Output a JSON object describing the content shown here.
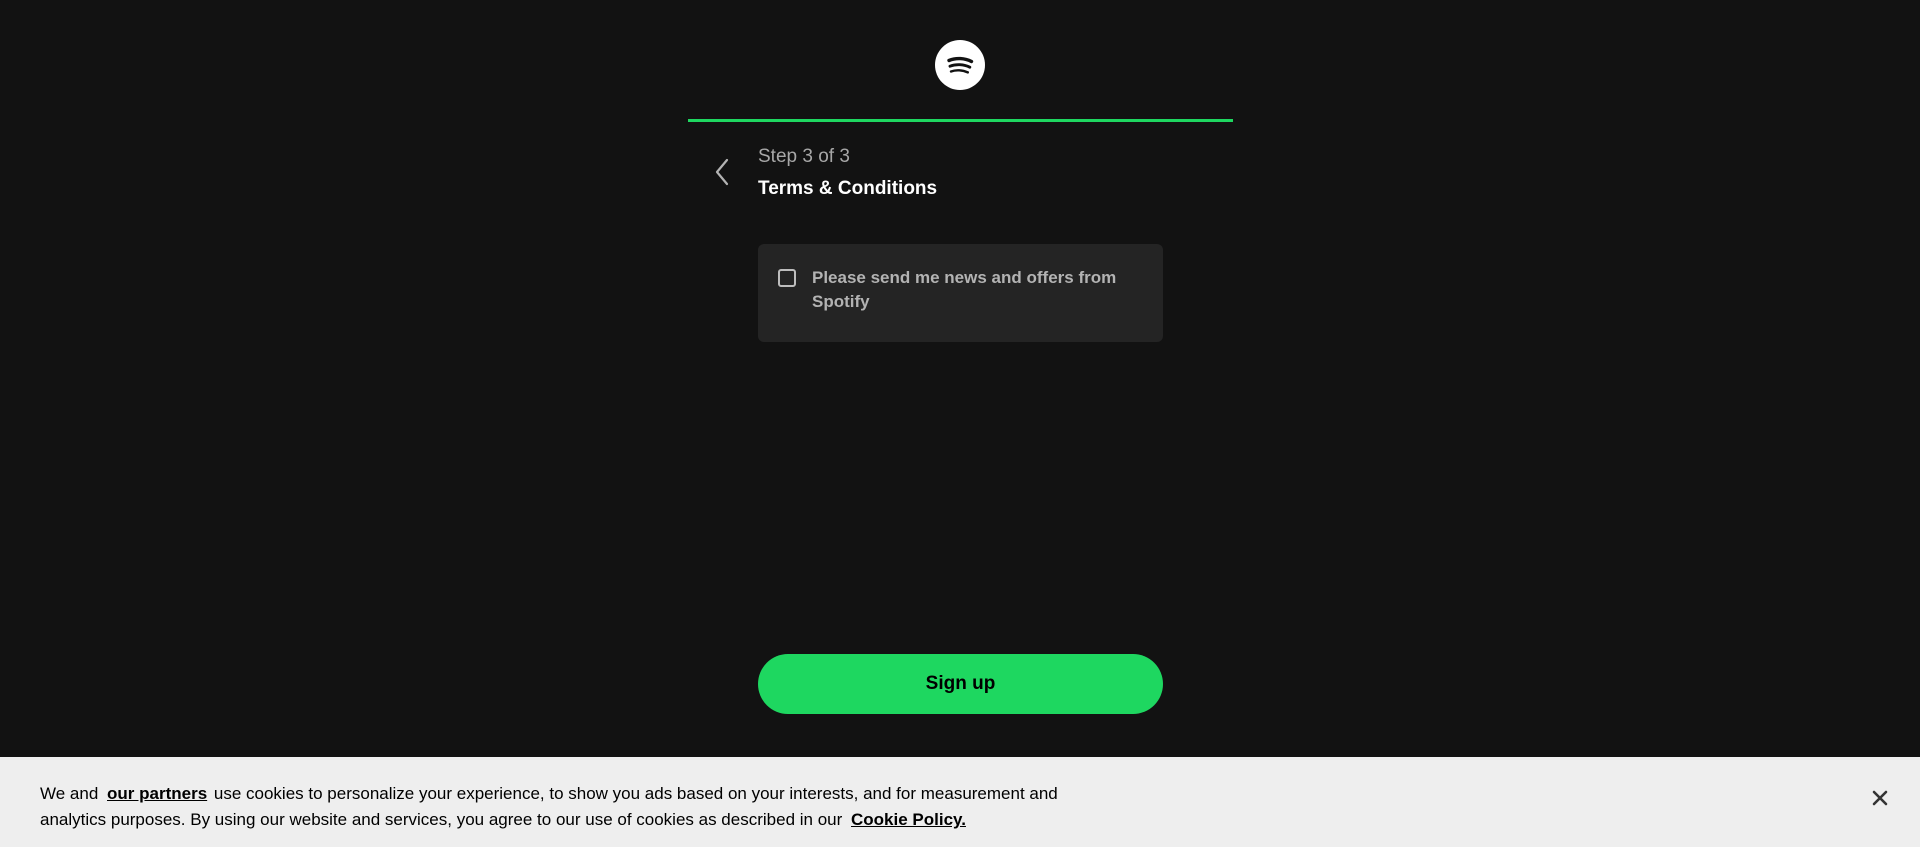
{
  "header": {
    "logo_icon": "spotify-logo-icon"
  },
  "progress": {
    "current_step": 3,
    "total_steps": 3,
    "fraction": 1.0,
    "fill_color": "#1ed760"
  },
  "step": {
    "back_icon": "chevron-left-icon",
    "label": "Step 3 of 3",
    "title": "Terms & Conditions"
  },
  "consent": {
    "checked": false,
    "label": "Please send me news and offers from Spotify"
  },
  "actions": {
    "signup_label": "Sign up",
    "accent_color": "#1ed760"
  },
  "cookie_banner": {
    "text_before_partners": "We and",
    "partners_link": "our partners",
    "text_after_partners": "use cookies to personalize your experience, to show you ads based on your interests, and for measurement and analytics purposes. By using our website and services, you agree to our use of cookies as described in our",
    "policy_link": "Cookie Policy.",
    "close_icon": "close-icon"
  }
}
